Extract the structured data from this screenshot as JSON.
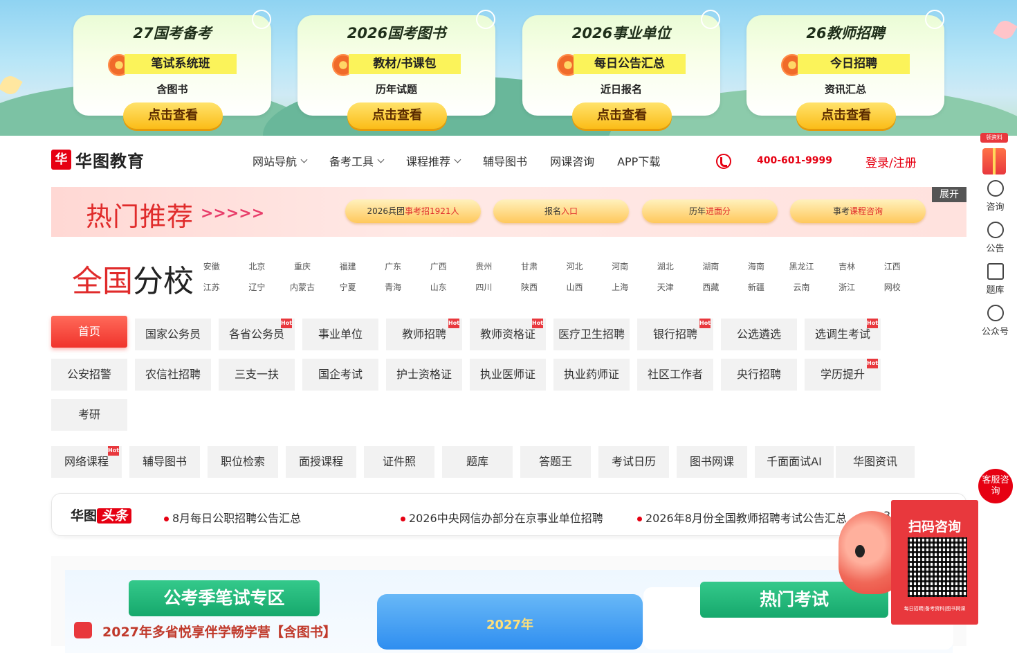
{
  "banner": {
    "cards": [
      {
        "title": "27国考备考",
        "tag": "笔试系统班",
        "sub": "含图书",
        "button": "点击查看"
      },
      {
        "title": "2026国考图书",
        "tag": "教材/书课包",
        "sub": "历年试题",
        "button": "点击查看"
      },
      {
        "title": "2026事业单位",
        "tag": "每日公告汇总",
        "sub": "近日报名",
        "button": "点击查看"
      },
      {
        "title": "26教师招聘",
        "tag": "今日招聘",
        "sub": "资讯汇总",
        "button": "点击查看"
      }
    ]
  },
  "header": {
    "logo_mark": "华",
    "logo_text": "华图教育",
    "nav": [
      "网站导航",
      "备考工具",
      "课程推荐",
      "辅导图书",
      "网课咨询",
      "APP下载"
    ],
    "phone": "400-601-9999",
    "login": "登录/注册"
  },
  "hot": {
    "title": "热门推荐",
    "arrows": ">>>>>",
    "expand": "展开",
    "buttons": [
      {
        "a": "2026兵团",
        "b": "事考招1921人"
      },
      {
        "a": "报名",
        "b": "入口"
      },
      {
        "a": "历年",
        "b": "进面分"
      },
      {
        "a": "事考",
        "b": "课程咨询"
      }
    ]
  },
  "branch": {
    "title_a": "全国",
    "title_b": "分校",
    "cities": [
      "安徽",
      "北京",
      "重庆",
      "福建",
      "广东",
      "广西",
      "贵州",
      "甘肃",
      "河北",
      "河南",
      "湖北",
      "湖南",
      "海南",
      "黑龙江",
      "吉林",
      "江西",
      "江苏",
      "辽宁",
      "内蒙古",
      "宁夏",
      "青海",
      "山东",
      "四川",
      "陕西",
      "山西",
      "上海",
      "天津",
      "西藏",
      "新疆",
      "云南",
      "浙江",
      "网校"
    ]
  },
  "categories": [
    {
      "label": "首页",
      "hot": false,
      "active": true
    },
    {
      "label": "国家公务员",
      "hot": false
    },
    {
      "label": "各省公务员",
      "hot": true
    },
    {
      "label": "事业单位",
      "hot": false
    },
    {
      "label": "教师招聘",
      "hot": true
    },
    {
      "label": "教师资格证",
      "hot": true
    },
    {
      "label": "医疗卫生招聘",
      "hot": false
    },
    {
      "label": "银行招聘",
      "hot": true
    },
    {
      "label": "公选遴选",
      "hot": false
    },
    {
      "label": "选调生考试",
      "hot": true
    },
    {
      "label": "公安招警",
      "hot": false
    },
    {
      "label": "农信社招聘",
      "hot": false
    },
    {
      "label": "三支一扶",
      "hot": false
    },
    {
      "label": "国企考试",
      "hot": false
    },
    {
      "label": "护士资格证",
      "hot": false
    },
    {
      "label": "执业医师证",
      "hot": false
    },
    {
      "label": "执业药师证",
      "hot": false
    },
    {
      "label": "社区工作者",
      "hot": false
    },
    {
      "label": "央行招聘",
      "hot": false
    },
    {
      "label": "学历提升",
      "hot": true
    },
    {
      "label": "考研",
      "hot": false
    }
  ],
  "hot_badge": "Hot",
  "tools": [
    {
      "label": "网络课程",
      "hot": true
    },
    {
      "label": "辅导图书"
    },
    {
      "label": "职位检索"
    },
    {
      "label": "面授课程"
    },
    {
      "label": "证件照"
    },
    {
      "label": "题库"
    },
    {
      "label": "答题王"
    },
    {
      "label": "考试日历"
    },
    {
      "label": "图书网课"
    },
    {
      "label": "千面面试AI"
    },
    {
      "label": "华图资讯"
    }
  ],
  "ticker": {
    "logo_a": "华图",
    "logo_b": "头条",
    "items": [
      "8月每日公职招聘公告汇总",
      "2026中央网信办部分在京事业单位招聘",
      "2026年8月份全国教师招聘考试公告汇总",
      "3"
    ]
  },
  "bottom": {
    "ribbon_left": "公考季笔试专区",
    "ribbon_right": "热门考试",
    "course": "2027年多省悦享伴学畅学营【含图书】",
    "banner_text": "2027年"
  },
  "sidebar": {
    "tag": "领资料",
    "items": [
      "咨询",
      "公告",
      "题库",
      "公众号"
    ],
    "service": "客服咨询"
  },
  "qr": {
    "title": "扫码咨询",
    "foot": "每日招聘|备考资料|图书网课"
  }
}
